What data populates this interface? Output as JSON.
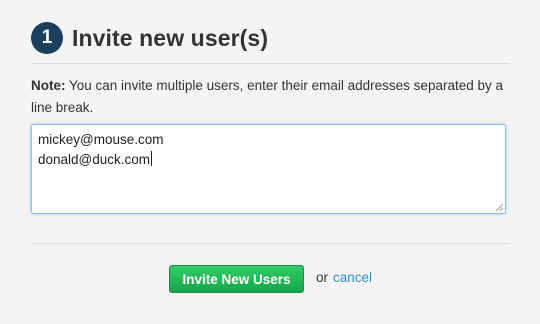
{
  "header": {
    "step_number": "1",
    "title": "Invite new user(s)"
  },
  "note": {
    "label": "Note:",
    "text": " You can invite multiple users, enter their email addresses separated by a line break."
  },
  "email_input": {
    "lines": [
      "mickey@mouse.com",
      "donald@duck.com"
    ]
  },
  "actions": {
    "invite_label": "Invite New Users",
    "or_text": "or",
    "cancel_label": "cancel"
  },
  "colors": {
    "badge": "#1d3f5e",
    "primary_button": "#22b857",
    "link": "#2b8fc7",
    "input_focus_border": "#8ec1e6"
  }
}
